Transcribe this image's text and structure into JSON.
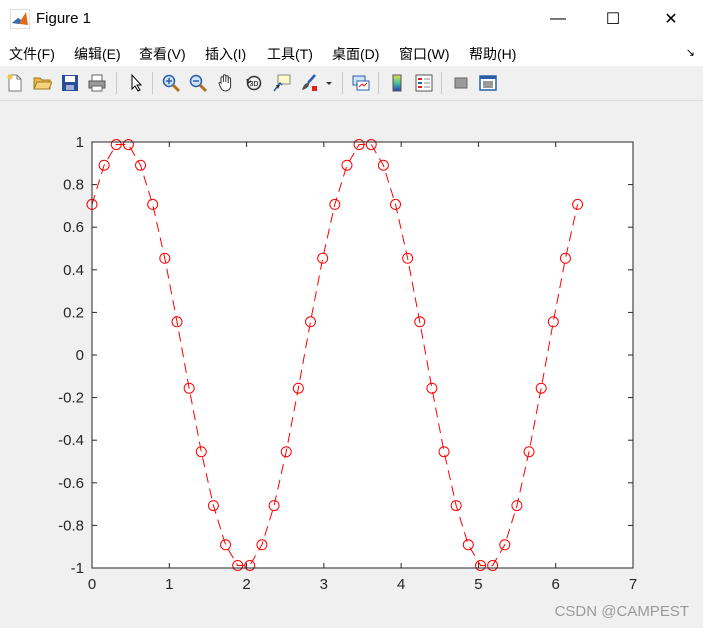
{
  "window": {
    "title": "Figure 1",
    "minimize_label": "—",
    "maximize_label": "☐",
    "close_label": "✕"
  },
  "menu": {
    "items": [
      "文件(F)",
      "编辑(E)",
      "查看(V)",
      "插入(I)",
      "工具(T)",
      "桌面(D)",
      "窗口(W)",
      "帮助(H)"
    ],
    "overflow_label": "↘"
  },
  "toolbar": {
    "icons": [
      "new-figure-icon",
      "open-file-icon",
      "save-icon",
      "print-icon",
      "pointer-icon",
      "zoom-in-icon",
      "zoom-out-icon",
      "pan-icon",
      "rotate-3d-icon",
      "data-cursor-icon",
      "brush-icon",
      "link-plot-icon",
      "colorbar-icon",
      "legend-icon",
      "hide-plot-tools-icon",
      "show-plot-tools-icon"
    ]
  },
  "watermark": "CSDN @CAMPEST",
  "chart_data": {
    "type": "line",
    "title": "",
    "xlabel": "",
    "ylabel": "",
    "xlim": [
      0,
      7
    ],
    "ylim": [
      -1,
      1
    ],
    "xticks": [
      "0",
      "1",
      "2",
      "3",
      "4",
      "5",
      "6",
      "7"
    ],
    "yticks": [
      "-1",
      "-0.8",
      "-0.6",
      "-0.4",
      "-0.2",
      "0",
      "0.2",
      "0.4",
      "0.6",
      "0.8",
      "1"
    ],
    "grid": false,
    "series": [
      {
        "color": "#ff0000",
        "line_style": "dashed",
        "marker": "circle",
        "x": [
          0.0,
          0.157,
          0.314,
          0.471,
          0.628,
          0.785,
          0.942,
          1.1,
          1.257,
          1.414,
          1.571,
          1.728,
          1.885,
          2.042,
          2.199,
          2.356,
          2.513,
          2.67,
          2.827,
          2.985,
          3.142,
          3.299,
          3.456,
          3.613,
          3.77,
          3.927,
          4.084,
          4.241,
          4.398,
          4.555,
          4.712,
          4.869,
          5.027,
          5.184,
          5.341,
          5.498,
          5.655,
          5.812,
          5.969,
          6.126,
          6.283
        ],
        "y": [
          0.707,
          0.891,
          0.988,
          0.988,
          0.891,
          0.707,
          0.454,
          0.156,
          -0.156,
          -0.454,
          -0.707,
          -0.891,
          -0.988,
          -0.988,
          -0.891,
          -0.707,
          -0.454,
          -0.156,
          0.156,
          0.454,
          0.707,
          0.891,
          0.988,
          0.988,
          0.891,
          0.707,
          0.454,
          0.156,
          -0.156,
          -0.454,
          -0.707,
          -0.891,
          -0.988,
          -0.988,
          -0.891,
          -0.707,
          -0.454,
          -0.156,
          0.156,
          0.454,
          0.707
        ]
      }
    ]
  }
}
